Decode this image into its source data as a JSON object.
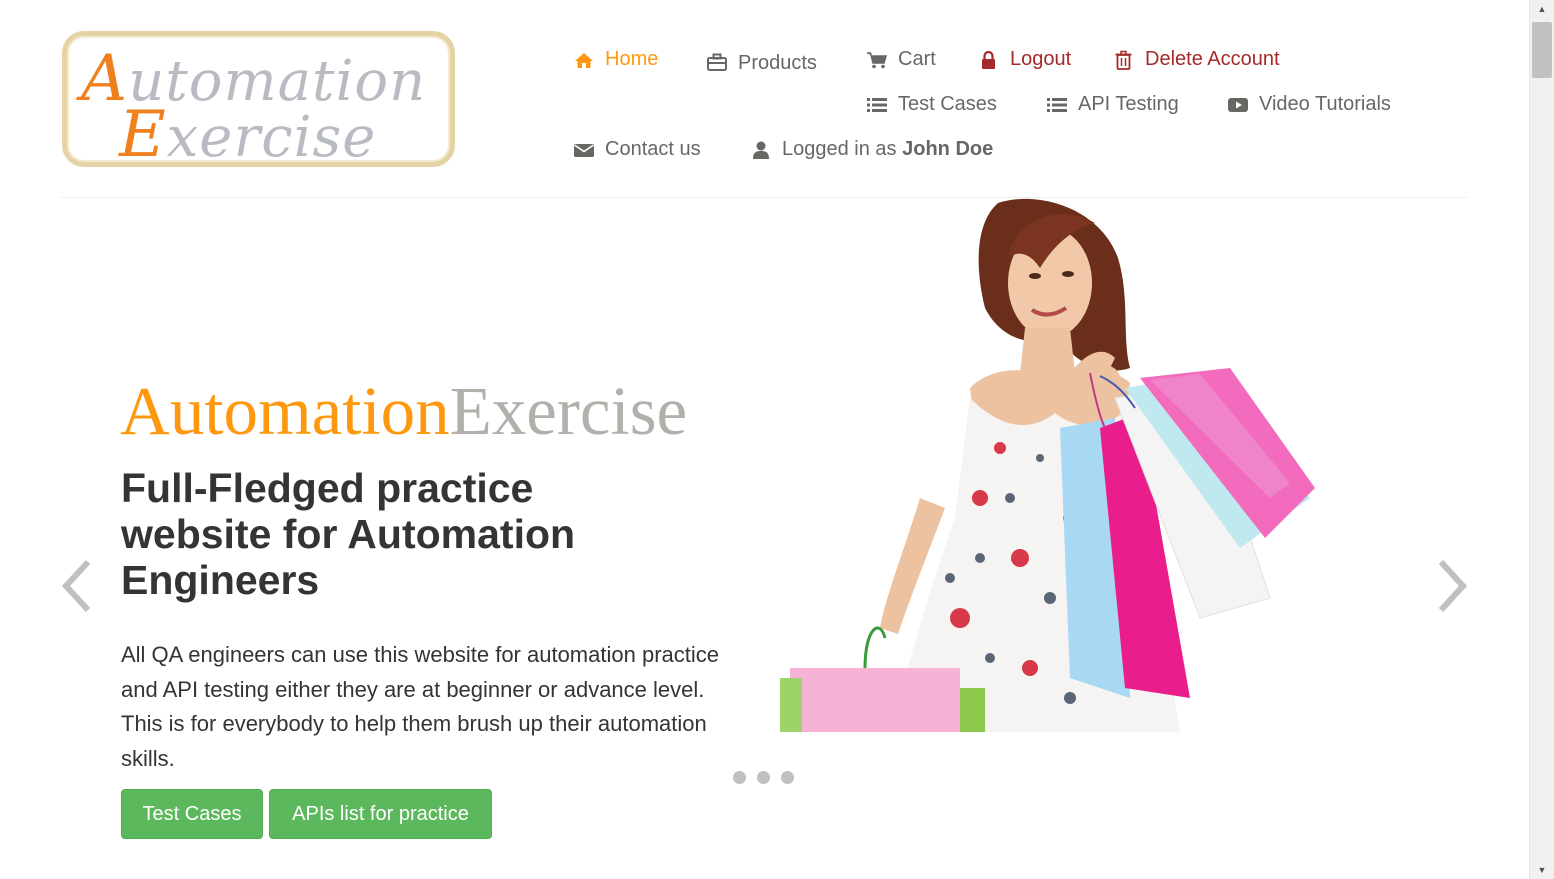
{
  "logo": {
    "line1_cap": "A",
    "line1_rest": "utomation",
    "line2_cap": "E",
    "line2_rest": "xercise"
  },
  "nav": {
    "home": "Home",
    "products": "Products",
    "cart": "Cart",
    "logout": "Logout",
    "delete_account": "Delete Account",
    "test_cases": "Test Cases",
    "api_testing": "API Testing",
    "video_tutorials": "Video Tutorials",
    "contact_us": "Contact us",
    "logged_in_prefix": "Logged in as",
    "user_name": "John Doe"
  },
  "slider": {
    "brand_part1": "Automation",
    "brand_part2": "Exercise",
    "headline": "Full-Fledged practice website for Automation Engineers",
    "description": "All QA engineers can use this website for automation practice and API testing either they are at beginner or advance level. This is for everybody to help them brush up their automation skills.",
    "btn_test_cases": "Test Cases",
    "btn_apis": "APIs list for practice",
    "active_slide": 0,
    "slide_count": 3
  },
  "icons": {
    "home": "home-icon",
    "products": "briefcase-icon",
    "cart": "shopping-cart-icon",
    "logout": "lock-icon",
    "delete": "trash-icon",
    "list": "list-icon",
    "video": "youtube-play-icon",
    "envelope": "envelope-icon",
    "user": "user-icon",
    "prev": "chevron-left-icon",
    "next": "chevron-right-icon"
  },
  "colors": {
    "accent": "#fe980f",
    "danger": "#a52a2a",
    "nav_text": "#696763",
    "button_green": "#5cb85c",
    "brand_gray": "#b3b0ab"
  }
}
